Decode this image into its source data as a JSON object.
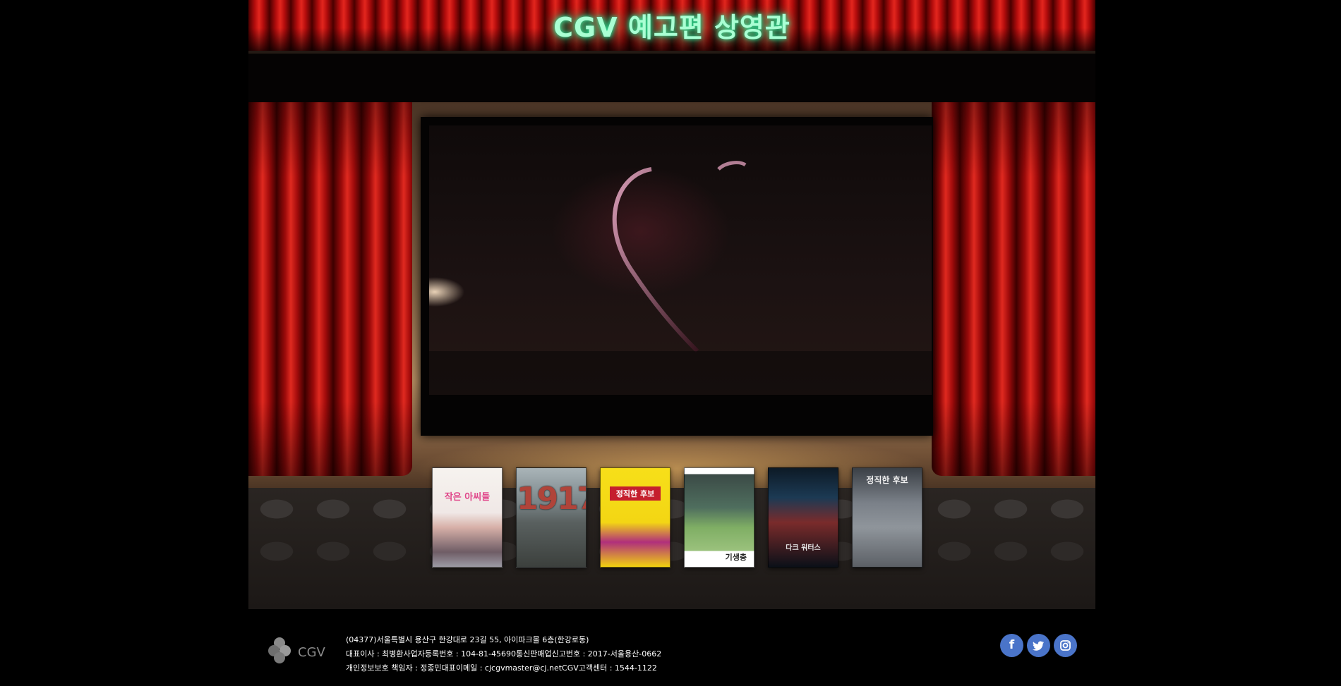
{
  "header": {
    "title": "CGV 예고편 상영관"
  },
  "theater": {
    "posters": [
      {
        "title": "작은 아씨들"
      },
      {
        "title": "1917"
      },
      {
        "title": "정직한 후보"
      },
      {
        "title": "기생충"
      },
      {
        "title": "다크 워터스"
      },
      {
        "title": "정직한 후보"
      }
    ]
  },
  "footer": {
    "logo_text": "CGV",
    "address_line": "(04377)서울특별시 용산구 한강대로 23길 55, 아이파크몰 6층(한강로동)",
    "business_line": "대표이사 : 최병환사업자등록번호 : 104-81-45690통신판매업신고번호 : 2017-서울용산-0662",
    "privacy_line": "개인정보보호 책임자 : 정종민대표이메일 : cjcgvmaster@cj.netCGV고객센터 : 1544-1122",
    "social": [
      "facebook-icon",
      "twitter-icon",
      "instagram-icon"
    ]
  },
  "colors": {
    "title_glow": "#35e39a",
    "curtain_red": "#e02a20",
    "social_blue": "#4a74c9"
  }
}
